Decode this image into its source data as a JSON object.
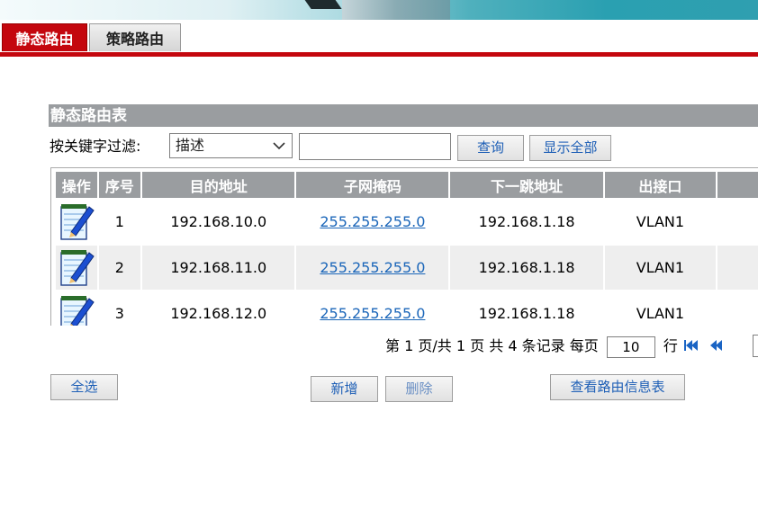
{
  "tabs": {
    "static_route": "静态路由",
    "policy_route": "策略路由"
  },
  "section": {
    "title": "静态路由表"
  },
  "filter": {
    "label": "按关键字过滤:",
    "selected": "描述",
    "value": "",
    "query_button": "查询",
    "show_all_button": "显示全部"
  },
  "table": {
    "headers": [
      "操作",
      "序号",
      "目的地址",
      "子网掩码",
      "下一跳地址",
      "出接口",
      ""
    ],
    "rows": [
      {
        "index": "1",
        "destination": "192.168.10.0",
        "mask": "255.255.255.0",
        "next_hop": "192.168.1.18",
        "interface": "VLAN1"
      },
      {
        "index": "2",
        "destination": "192.168.11.0",
        "mask": "255.255.255.0",
        "next_hop": "192.168.1.18",
        "interface": "VLAN1"
      },
      {
        "index": "3",
        "destination": "192.168.12.0",
        "mask": "255.255.255.0",
        "next_hop": "192.168.1.18",
        "interface": "VLAN1"
      }
    ]
  },
  "pager": {
    "prefix": "第",
    "current_page": "1",
    "mid1": "页/共",
    "total_pages": "1",
    "mid2": "页 共",
    "total_records": "4",
    "mid3": "条记录 每页",
    "per_page": "10",
    "suffix": "行"
  },
  "actions": {
    "select_all": "全选",
    "add": "新增",
    "delete": "删除",
    "view_route_info": "查看路由信息表"
  },
  "icons": {
    "edit": "notepad-pen-icon",
    "first_page": "first-page-icon",
    "prev_page": "prev-page-icon"
  },
  "colors": {
    "accent_red": "#c4070e",
    "header_grey": "#9a9da0",
    "link_blue": "#1b66b9"
  }
}
